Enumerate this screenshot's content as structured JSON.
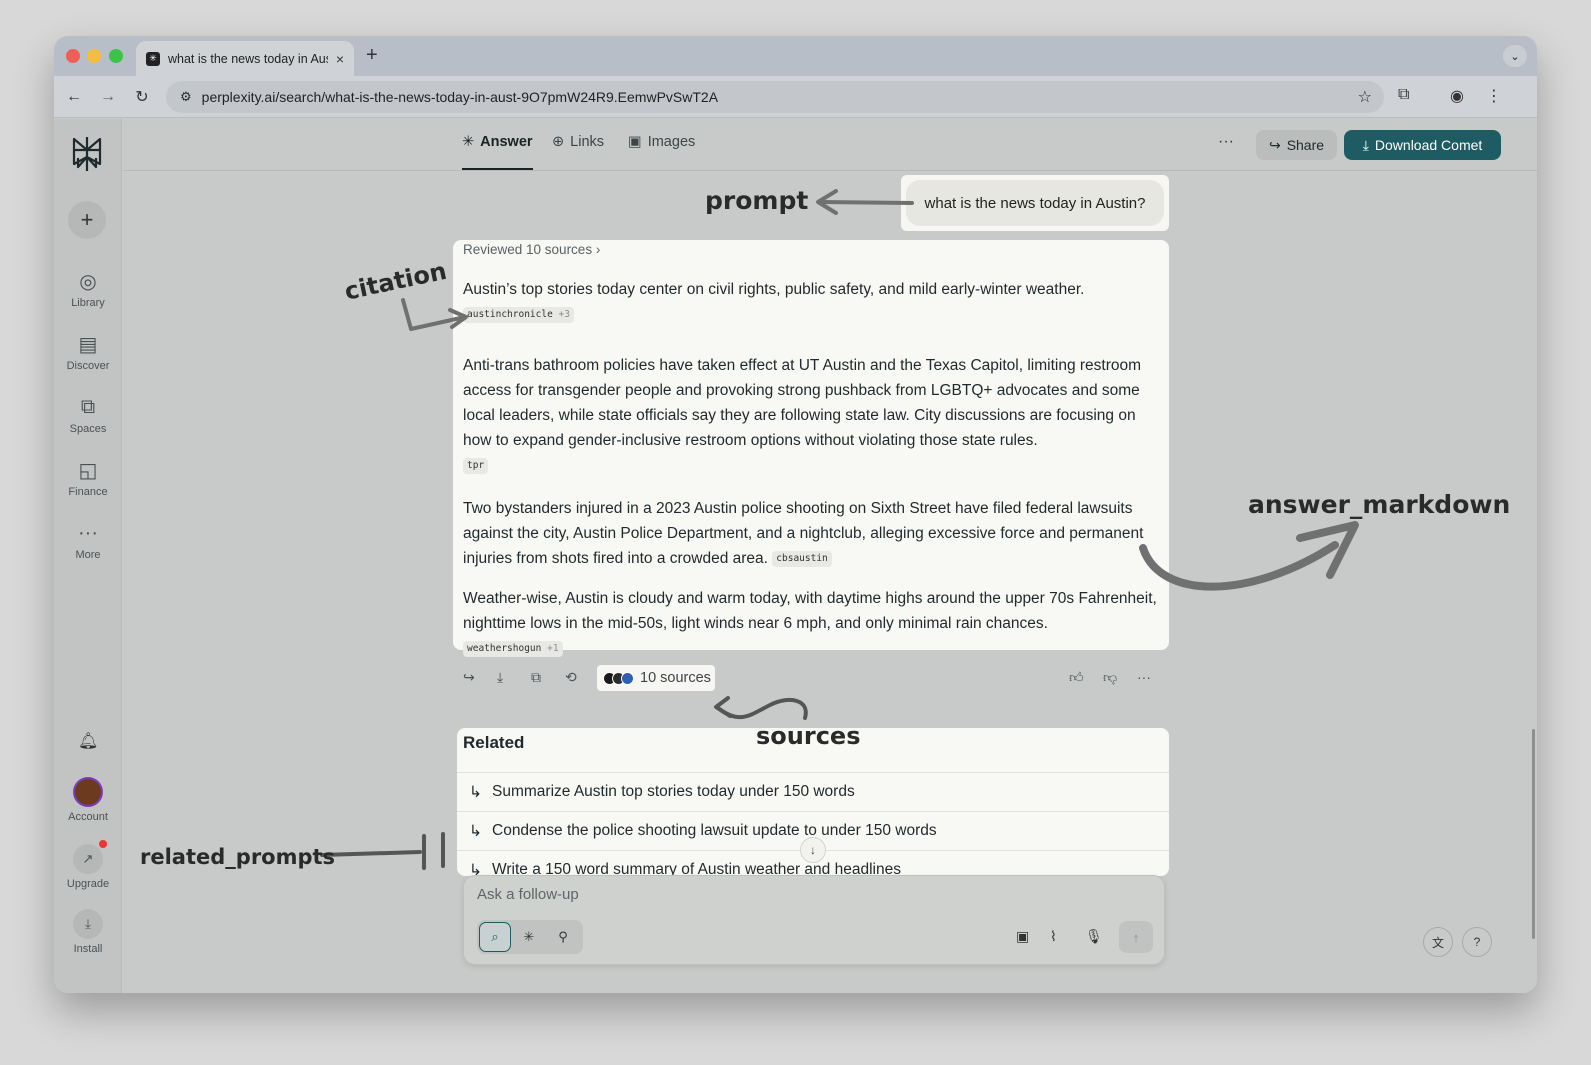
{
  "browser": {
    "tab_title": "what is the news today in Aus",
    "url": "perplexity.ai/search/what-is-the-news-today-in-aust-9O7pmW24R9.EemwPvSwT2A"
  },
  "sidebar": {
    "items": [
      {
        "label": "Library",
        "icon": "library-icon"
      },
      {
        "label": "Discover",
        "icon": "discover-icon"
      },
      {
        "label": "Spaces",
        "icon": "spaces-icon"
      },
      {
        "label": "Finance",
        "icon": "finance-icon"
      },
      {
        "label": "More",
        "icon": "more-icon"
      }
    ],
    "account_label": "Account",
    "upgrade_label": "Upgrade",
    "install_label": "Install"
  },
  "header": {
    "tabs": [
      {
        "label": "Answer",
        "icon": "answer-icon",
        "active": true
      },
      {
        "label": "Links",
        "icon": "globe-icon"
      },
      {
        "label": "Images",
        "icon": "image-icon"
      }
    ],
    "share_label": "Share",
    "download_label": "Download Comet",
    "accent_color": "#1e5c63"
  },
  "prompt": {
    "text": "what is the news today in Austin?"
  },
  "answer": {
    "reviewed": "Reviewed 10 sources",
    "paragraphs": [
      {
        "text": "Austin’s top stories today center on civil rights, public safety, and mild early-winter weather.",
        "citation": "austinchronicle",
        "citation_extra": "+3"
      },
      {
        "text": "Anti-trans bathroom policies have taken effect at UT Austin and the Texas Capitol, limiting restroom access for transgender people and provoking strong pushback from LGBTQ+ advocates and some local leaders, while state officials say they are following state law. City discussions are focusing on how to expand gender-inclusive restroom options without violating those state rules.",
        "citation": "tpr",
        "citation_extra": ""
      },
      {
        "text": "Two bystanders injured in a 2023 Austin police shooting on Sixth Street have filed federal lawsuits against the city, Austin Police Department, and a nightclub, alleging excessive force and permanent injuries from shots fired into a crowded area.",
        "citation": "cbsaustin",
        "citation_extra": ""
      },
      {
        "text": "Weather-wise, Austin is cloudy and warm today, with daytime highs around the upper 70s Fahrenheit, nighttime lows in the mid-50s, light winds near 6 mph, and only minimal rain chances.",
        "citation": "weathershogun",
        "citation_extra": "+1"
      }
    ]
  },
  "sources": {
    "label": "10 sources"
  },
  "related": {
    "title": "Related",
    "items": [
      "Summarize Austin top stories today under 150 words",
      "Condense the police shooting lawsuit update to under 150 words",
      "Write a 150 word summary of Austin weather and headlines"
    ]
  },
  "followup": {
    "placeholder": "Ask a follow-up"
  },
  "annotations": {
    "prompt": "prompt",
    "citation": "citation",
    "answer_markdown": "answer_markdown",
    "sources": "sources",
    "related_prompts": "related_prompts"
  }
}
